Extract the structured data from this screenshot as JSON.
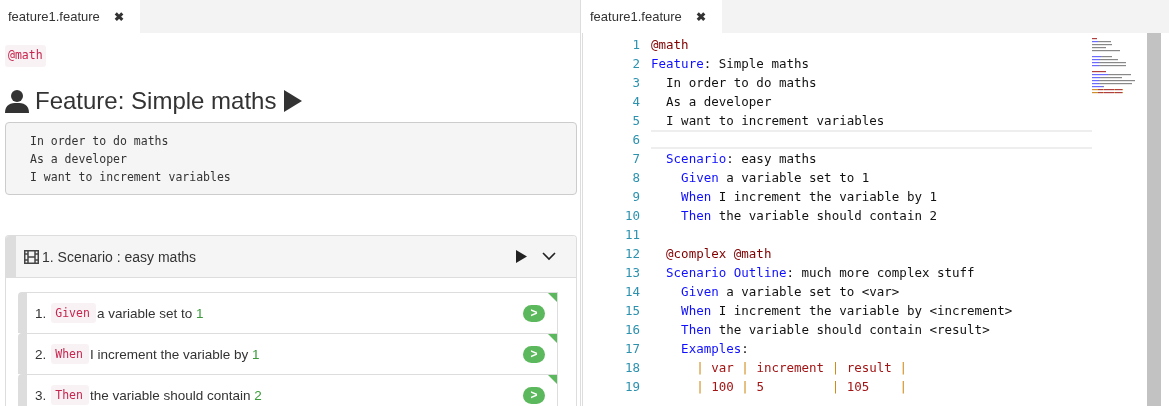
{
  "left_pane": {
    "tab": {
      "label": "feature1.feature",
      "close": "✖",
      "selected": true
    },
    "tag": "@math",
    "feature_title": "Feature: Simple maths",
    "description": [
      "In order to do maths",
      "As a developer",
      "I want to increment variables"
    ],
    "scenario": {
      "title": "1. Scenario : easy maths",
      "expanded": true,
      "steps": [
        {
          "number": "1.",
          "keyword": "Given",
          "text": "a variable set to ",
          "argument": "1",
          "passed": true,
          "run": ">"
        },
        {
          "number": "2.",
          "keyword": "When",
          "text": "I increment the variable by ",
          "argument": "1",
          "passed": true,
          "run": ">"
        },
        {
          "number": "3.",
          "keyword": "Then",
          "text": "the variable should contain ",
          "argument": "2",
          "passed": true,
          "run": ">"
        }
      ]
    }
  },
  "editor": {
    "tab": {
      "label": "feature1.feature",
      "close": "✖",
      "selected": true
    },
    "lines": [
      {
        "number": "1",
        "current": false,
        "tokens": [
          {
            "kind": "tag",
            "text": "@math"
          }
        ]
      },
      {
        "number": "2",
        "current": false,
        "tokens": [
          {
            "kind": "keyword",
            "text": "Feature"
          },
          {
            "kind": "text",
            "text": ": Simple maths"
          }
        ]
      },
      {
        "number": "3",
        "current": false,
        "tokens": [
          {
            "kind": "text",
            "text": "  In order to do maths"
          }
        ]
      },
      {
        "number": "4",
        "current": false,
        "tokens": [
          {
            "kind": "text",
            "text": "  As a developer"
          }
        ]
      },
      {
        "number": "5",
        "current": false,
        "tokens": [
          {
            "kind": "text",
            "text": "  I want to increment variables"
          }
        ]
      },
      {
        "number": "6",
        "current": true
      },
      {
        "number": "7",
        "current": false,
        "tokens": [
          {
            "kind": "keyword",
            "text": "  Scenario"
          },
          {
            "kind": "text",
            "text": ": easy maths"
          }
        ]
      },
      {
        "number": "8",
        "current": false,
        "tokens": [
          {
            "kind": "keyword",
            "text": "    Given"
          },
          {
            "kind": "text",
            "text": " a variable set to 1"
          }
        ]
      },
      {
        "number": "9",
        "current": false,
        "tokens": [
          {
            "kind": "keyword",
            "text": "    When"
          },
          {
            "kind": "text",
            "text": " I increment the variable by 1"
          }
        ]
      },
      {
        "number": "10",
        "current": false,
        "tokens": [
          {
            "kind": "keyword",
            "text": "    Then"
          },
          {
            "kind": "text",
            "text": " the variable should contain 2"
          }
        ]
      },
      {
        "number": "11",
        "current": false
      },
      {
        "number": "12",
        "current": false,
        "tokens": [
          {
            "kind": "tag",
            "text": "  @complex @math"
          }
        ]
      },
      {
        "number": "13",
        "current": false,
        "tokens": [
          {
            "kind": "keyword",
            "text": "  Scenario Outline"
          },
          {
            "kind": "text",
            "text": ": much more complex stuff"
          }
        ]
      },
      {
        "number": "14",
        "current": false,
        "tokens": [
          {
            "kind": "keyword",
            "text": "    Given"
          },
          {
            "kind": "text",
            "text": " a variable set to <var>"
          }
        ]
      },
      {
        "number": "15",
        "current": false,
        "tokens": [
          {
            "kind": "keyword",
            "text": "    When"
          },
          {
            "kind": "text",
            "text": " I increment the variable by <increment>"
          }
        ]
      },
      {
        "number": "16",
        "current": false,
        "tokens": [
          {
            "kind": "keyword",
            "text": "    Then"
          },
          {
            "kind": "text",
            "text": " the variable should contain <result>"
          }
        ]
      },
      {
        "number": "17",
        "current": false,
        "tokens": [
          {
            "kind": "keyword",
            "text": "    Examples"
          },
          {
            "kind": "text",
            "text": ":"
          }
        ]
      },
      {
        "number": "18",
        "current": false,
        "tokens": [
          {
            "kind": "pipe",
            "text": "      |"
          },
          {
            "kind": "cell",
            "text": " var "
          },
          {
            "kind": "pipe",
            "text": "|"
          },
          {
            "kind": "cell",
            "text": " increment "
          },
          {
            "kind": "pipe",
            "text": "|"
          },
          {
            "kind": "cell",
            "text": " result "
          },
          {
            "kind": "pipe",
            "text": "|"
          }
        ]
      },
      {
        "number": "19",
        "current": false,
        "tokens": [
          {
            "kind": "pipe",
            "text": "      |"
          },
          {
            "kind": "cell",
            "text": " 100 "
          },
          {
            "kind": "pipe",
            "text": "|"
          },
          {
            "kind": "cell",
            "text": " 5         "
          },
          {
            "kind": "pipe",
            "text": "|"
          },
          {
            "kind": "cell",
            "text": " 105    "
          },
          {
            "kind": "pipe",
            "text": "|"
          }
        ]
      }
    ]
  }
}
